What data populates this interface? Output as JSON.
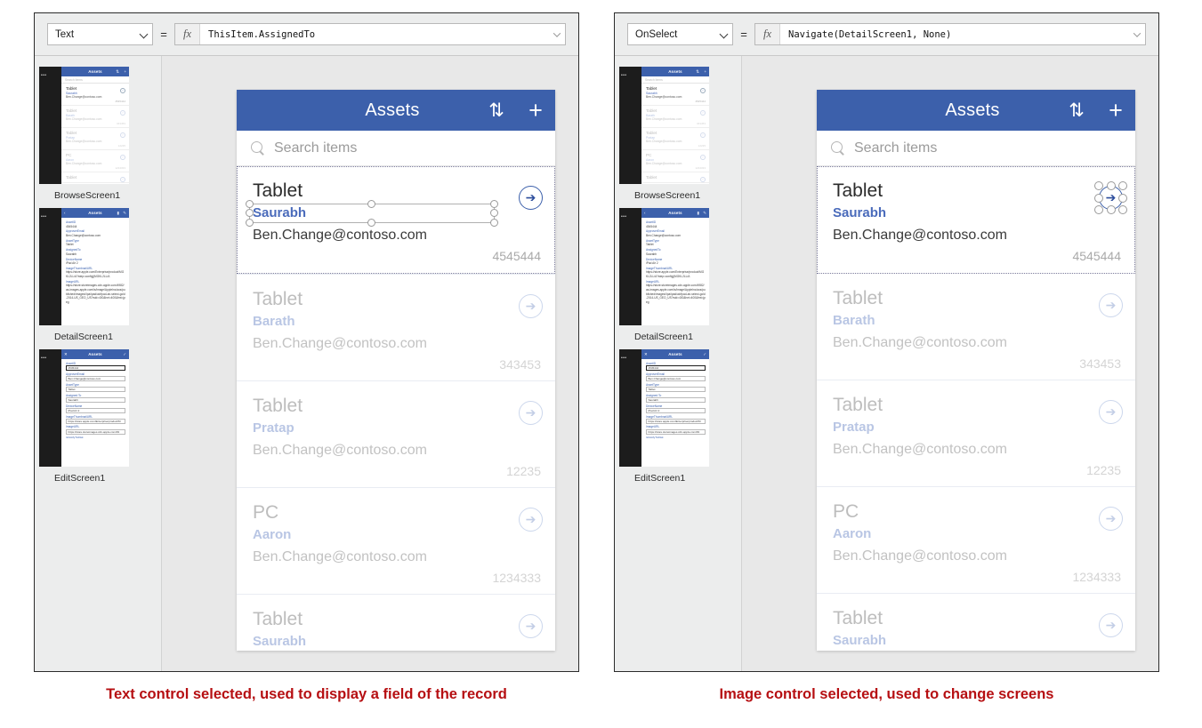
{
  "panels": [
    {
      "id": "left",
      "formula_bar": {
        "property": "Text",
        "equals": "=",
        "fx_label": "fx",
        "formula": "ThisItem.AssignedTo",
        "dropdown_icon": "chevron-down-icon",
        "expand_icon": "chevron-down-icon"
      },
      "caption": "Text control selected, used to display a field of the record",
      "selection": {
        "target": "text-control",
        "control": "Saurabh"
      }
    },
    {
      "id": "right",
      "formula_bar": {
        "property": "OnSelect",
        "equals": "=",
        "fx_label": "fx",
        "formula": "Navigate(DetailScreen1, None)",
        "dropdown_icon": "chevron-down-icon",
        "expand_icon": "chevron-down-icon"
      },
      "caption": "Image control selected, used to change screens",
      "selection": {
        "target": "image-control",
        "control": "next-arrow-icon"
      }
    }
  ],
  "screen_thumbnails": [
    {
      "label": "BrowseScreen1",
      "type": "browse",
      "header": {
        "title": "Assets",
        "left_icon": "",
        "right_icon_1": "sort-icon",
        "right_icon_2": "plus-icon"
      },
      "search_placeholder": "Search items",
      "rows": [
        {
          "title": "Tablet",
          "sub": "Saurabh",
          "mail": "Ben.Change@contoso.com",
          "num": "4545444",
          "dim": false
        },
        {
          "title": "Tablet",
          "sub": "Barath",
          "mail": "Ben.Change@contoso.com",
          "num": "343453",
          "dim": true
        },
        {
          "title": "Tablet",
          "sub": "Pratap",
          "mail": "Ben.Change@contoso.com",
          "num": "12235",
          "dim": true
        },
        {
          "title": "PC",
          "sub": "Aaron",
          "mail": "Ben.Change@contoso.com",
          "num": "1234333",
          "dim": true
        },
        {
          "title": "Tablet",
          "sub": "Saurabh",
          "mail": "",
          "num": "",
          "dim": true
        }
      ]
    },
    {
      "label": "DetailScreen1",
      "type": "detail",
      "header": {
        "title": "Assets",
        "left_icon": "back-arrow-icon",
        "right_icon_1": "trash-icon",
        "right_icon_2": "edit-pencil-icon"
      },
      "fields": [
        {
          "label": "AssetID",
          "value": "4545444"
        },
        {
          "label": "ApproverEmail",
          "value": "Ben.Change@contoso.com"
        },
        {
          "label": "AssetType",
          "value": "Tablet"
        },
        {
          "label": "AssignedTo",
          "value": "Saurabh"
        },
        {
          "label": "DeviceName",
          "value": "iPad Air 2"
        },
        {
          "label": "ImageThumbnailURL",
          "value": "https://store.apple.com/Enterprise/product/MGKL2LL/A?step=config||MGKL2LL/A"
        },
        {
          "label": "ImageURL",
          "value": "https://store.storeimages.cdn-apple.com/4982/as-images.apple.com/is/image/AppleInc/aos/published/images/i/pa/ipad/air/ipad-air-select-gold-2014-US_GEO_US?wid=400&hei=400&fmt=jpeg"
        }
      ]
    },
    {
      "label": "EditScreen1",
      "type": "edit",
      "header": {
        "title": "Assets",
        "left_icon": "close-icon",
        "right_icon_1": "",
        "right_icon_2": "check-icon"
      },
      "fields": [
        {
          "label": "AssetID",
          "value": "4545444",
          "focused": true
        },
        {
          "label": "ApproverEmail",
          "value": "Ben.Change@contoso.com",
          "focused": false
        },
        {
          "label": "AssetType",
          "value": "Tablet",
          "focused": false
        },
        {
          "label": "Assigned To",
          "value": "Saurabh",
          "focused": false
        },
        {
          "label": "DeviceName",
          "value": "iPad Air 2",
          "focused": false
        },
        {
          "label": "ImageThumbnailURL",
          "value": "https://store.apple.com/Enterprise/product/M",
          "focused": false
        },
        {
          "label": "ImageURL",
          "value": "https://store.storeimages.cdn-apple.com/49",
          "focused": false
        }
      ],
      "footer_link": "IsNotifyToDisk"
    }
  ],
  "app": {
    "header": {
      "title": "Assets",
      "sort_icon": "sort-icon",
      "add_icon": "plus-icon"
    },
    "search": {
      "placeholder": "Search items",
      "icon": "search-icon"
    },
    "rows": [
      {
        "title": "Tablet",
        "sub": "Saurabh",
        "mail": "Ben.Change@contoso.com",
        "num": "4545444",
        "dim": false,
        "arrow_icon": "next-arrow-icon"
      },
      {
        "title": "Tablet",
        "sub": "Barath",
        "mail": "Ben.Change@contoso.com",
        "num": "343453",
        "dim": true,
        "arrow_icon": "next-arrow-icon"
      },
      {
        "title": "Tablet",
        "sub": "Pratap",
        "mail": "Ben.Change@contoso.com",
        "num": "12235",
        "dim": true,
        "arrow_icon": "next-arrow-icon"
      },
      {
        "title": "PC",
        "sub": "Aaron",
        "mail": "Ben.Change@contoso.com",
        "num": "1234333",
        "dim": true,
        "arrow_icon": "next-arrow-icon"
      },
      {
        "title": "Tablet",
        "sub": "Saurabh",
        "mail": "",
        "num": "",
        "dim": true,
        "arrow_icon": "next-arrow-icon"
      }
    ]
  },
  "colors": {
    "brand_blue": "#3c60ab",
    "accent_link": "#4a6bbb",
    "caption_red": "#b60f12",
    "canvas_gray": "#e8e8e8",
    "chrome_gray": "#eceded"
  }
}
